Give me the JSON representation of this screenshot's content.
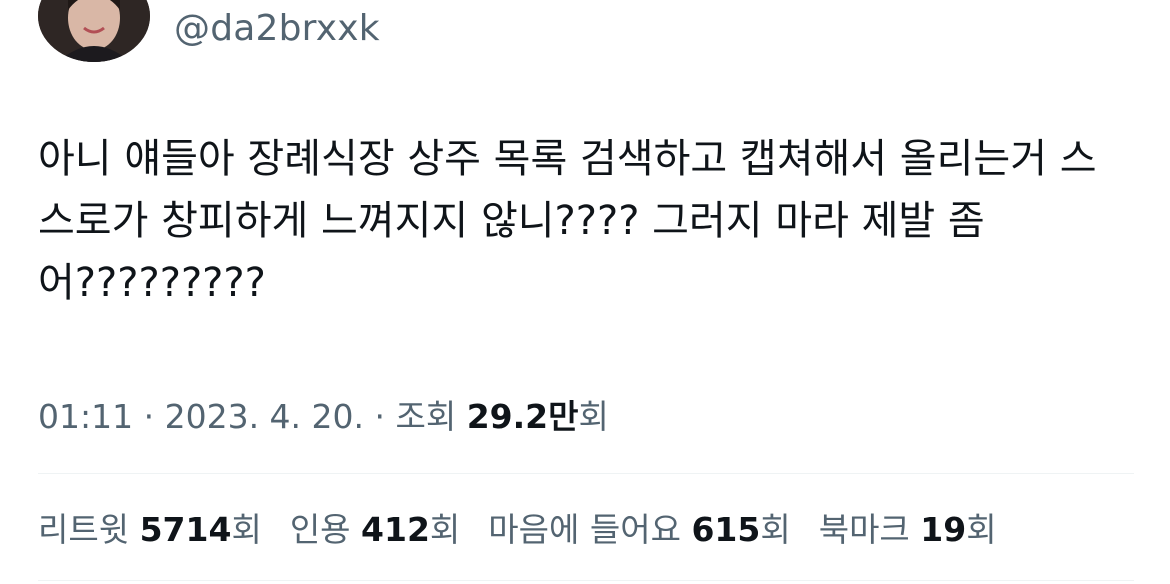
{
  "author": {
    "handle": "@da2brxxk"
  },
  "tweet": {
    "text": "아니 얘들아 장례식장 상주 목록 검색하고 캡쳐해서 올리는거 스\n스로가 창피하게 느껴지지 않니???? 그러지 마라 제발 좀\n어?????????"
  },
  "meta": {
    "time": "01:11",
    "sep1": " · ",
    "date": "2023. 4. 20.",
    "sep2": " · ",
    "views_label": "조회 ",
    "views_value": "29.2만",
    "views_unit": "회"
  },
  "stats": [
    {
      "label": "리트윗 ",
      "value": "5714",
      "unit": "회"
    },
    {
      "label": "인용 ",
      "value": "412",
      "unit": "회"
    },
    {
      "label": "마음에 들어요 ",
      "value": "615",
      "unit": "회"
    },
    {
      "label": "북마크 ",
      "value": "19",
      "unit": "회"
    }
  ]
}
